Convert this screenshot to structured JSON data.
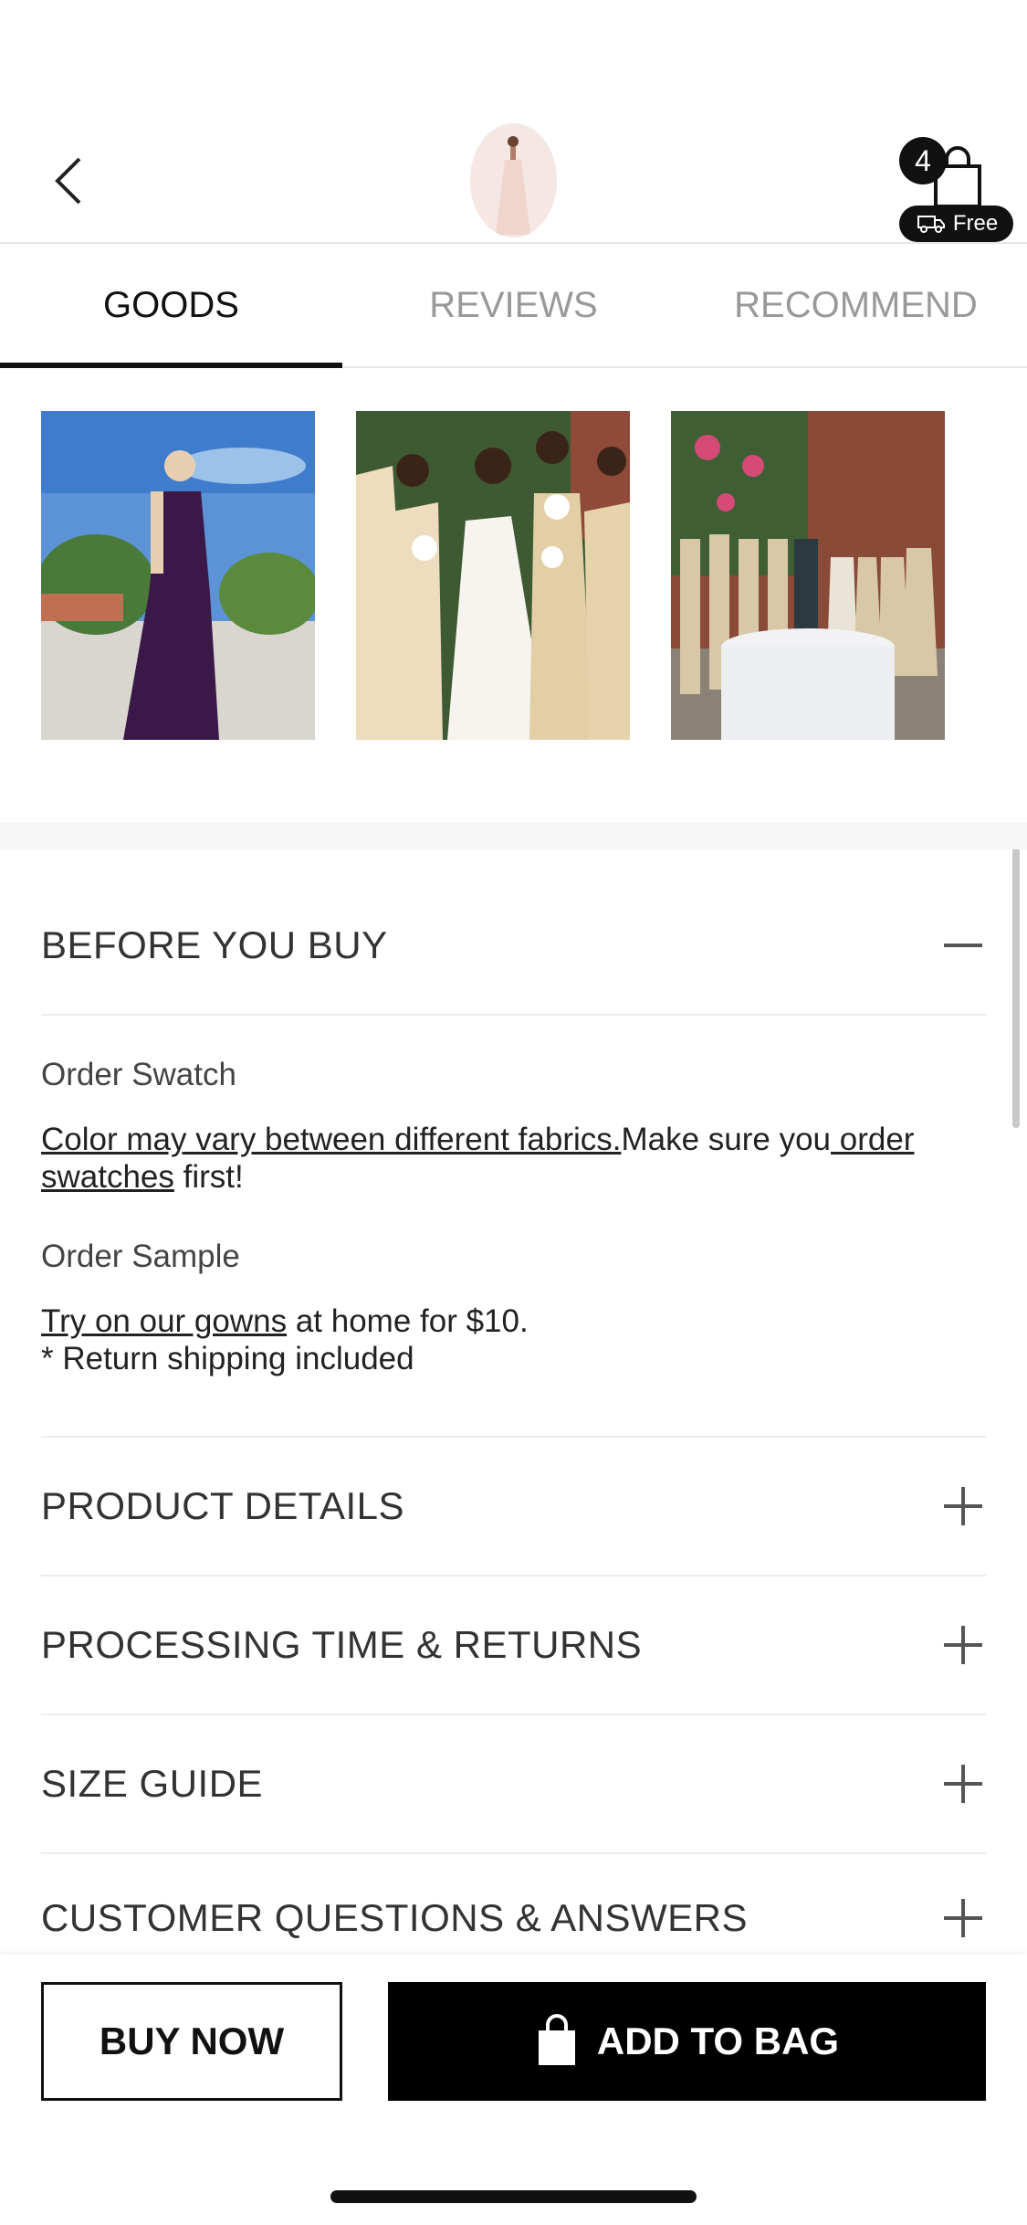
{
  "header": {
    "cart_count": "4",
    "free_label": "Free"
  },
  "tabs": [
    {
      "label": "GOODS",
      "active": true
    },
    {
      "label": "REVIEWS",
      "active": false
    },
    {
      "label": "RECOMMEND",
      "active": false
    }
  ],
  "sections": {
    "before_you_buy": {
      "title": "BEFORE YOU BUY",
      "order_swatch_title": "Order Swatch",
      "swatch_link1": "Color may vary between different fabrics.",
      "swatch_text1": "Make sure you",
      "swatch_link2": " order swatches",
      "swatch_text2": " first!",
      "order_sample_title": "Order Sample",
      "sample_link": "Try on our gowns",
      "sample_text": " at home for $10.",
      "sample_note": "* Return shipping included"
    },
    "product_details": "PRODUCT DETAILS",
    "processing": "PROCESSING TIME & RETURNS",
    "size_guide": "SIZE GUIDE",
    "qa": "CUSTOMER QUESTIONS & ANSWERS"
  },
  "bottom_bar": {
    "buy_now": "BUY NOW",
    "add_to_bag": "ADD TO BAG"
  },
  "colors": {
    "accent": "#000000",
    "text": "#222222",
    "inactive_tab": "#999999",
    "divider": "#ececec"
  }
}
